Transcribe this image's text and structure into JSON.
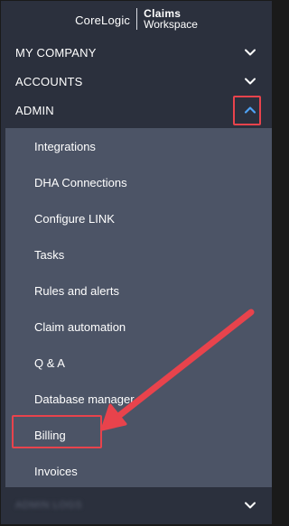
{
  "brand": {
    "left": "CoreLogic",
    "right_line1": "Claims",
    "right_line2": "Workspace"
  },
  "nav": {
    "sections": [
      {
        "label": "MY COMPANY",
        "icon": "chevron-down-icon"
      },
      {
        "label": "ACCOUNTS",
        "icon": "chevron-down-icon"
      },
      {
        "label": "ADMIN",
        "icon": "chevron-up-icon"
      }
    ],
    "admin_items": [
      {
        "label": "Integrations"
      },
      {
        "label": "DHA Connections"
      },
      {
        "label": "Configure LINK"
      },
      {
        "label": "Tasks"
      },
      {
        "label": "Rules and alerts"
      },
      {
        "label": "Claim automation"
      },
      {
        "label": "Q & A"
      },
      {
        "label": "Database manager"
      },
      {
        "label": "Billing"
      },
      {
        "label": "Invoices"
      }
    ],
    "bottom_section": {
      "label": "ADMIN LOGS",
      "icon": "chevron-down-icon"
    }
  },
  "colors": {
    "sidebar_bg": "#2b303d",
    "submenu_bg": "#4c5466",
    "highlight": "#e8434c",
    "chevron_up": "#4fa3f7"
  }
}
